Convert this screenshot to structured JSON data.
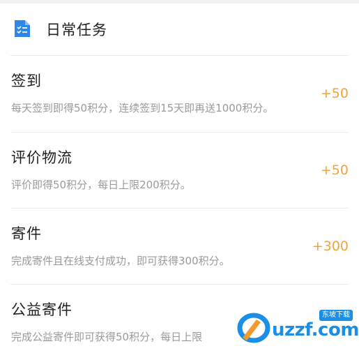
{
  "section": {
    "title": "日常任务",
    "icon": "task-list-icon",
    "icon_color": "#2f86ea"
  },
  "tasks": [
    {
      "title": "签到",
      "description": "每天签到即得50积分，连续签到15天即再送1000积分。",
      "points": "+50"
    },
    {
      "title": "评价物流",
      "description": "评价即得50积分，每日上限200积分。",
      "points": "+50"
    },
    {
      "title": "寄件",
      "description": "完成寄件且在线支付成功，即可获得300积分。",
      "points": "+300"
    },
    {
      "title": "公益寄件",
      "description": "完成公益寄件即可获得50积分，每日上限",
      "points": ""
    }
  ],
  "watermark": {
    "text": "uzzf.com",
    "badge": "东坡下载"
  },
  "colors": {
    "points": "#f0a341",
    "title": "#1f1f1f",
    "description": "#9a9a9a",
    "divider": "#ebebeb",
    "brand_blue": "#1a8fe3"
  }
}
